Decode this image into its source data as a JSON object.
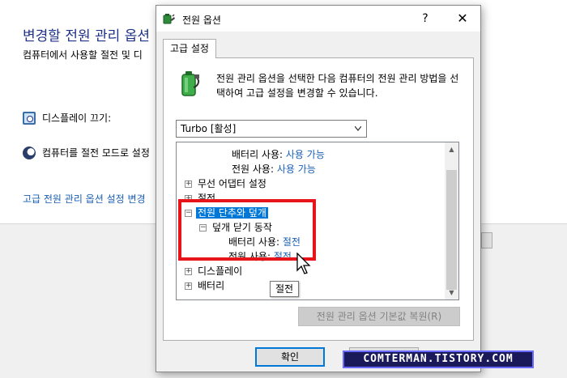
{
  "background": {
    "title": "변경할 전원 관리 옵션",
    "subtitle": "컴퓨터에서 사용할 절전 및 디",
    "display_off_label": "디스플레이 끄기:",
    "sleep_label": "컴퓨터를 절전 모드로 설정",
    "advanced_link": "고급 전원 관리 옵션 설정 변경"
  },
  "dialog": {
    "title": "전원 옵션",
    "help_label": "?",
    "close_label": "✕",
    "tab_label": "고급 설정",
    "description": "전원 관리 옵션을 선택한 다음 컴퓨터의 전원 관리 방법을 선택하여 고급 설정을 변경할 수 있습니다.",
    "plan_selected": "Turbo [활성]",
    "tree": {
      "row1_label": "배터리 사용:",
      "row1_value": "사용 가능",
      "row2_label": "전원 사용:",
      "row2_value": "사용 가능",
      "wireless": "무선 어댑터 설정",
      "sleep": "절전",
      "power_buttons": "전원 단추와 덮개",
      "lid_action": "덮개 닫기 동작",
      "lid_battery_label": "배터리 사용:",
      "lid_battery_value": "절전",
      "lid_plugged_label": "전원 사용:",
      "lid_plugged_value": "절전",
      "display": "디스플레이",
      "battery": "배터리"
    },
    "tooltip": "절전",
    "restore_button": "전원 관리 옵션 기본값 복원(R)",
    "ok_button": "확인"
  },
  "watermark": "COMTERMAN.TISTORY.COM",
  "colors": {
    "highlight": "#e8131b",
    "selection": "#0078d7",
    "link": "#1a5fb4"
  }
}
